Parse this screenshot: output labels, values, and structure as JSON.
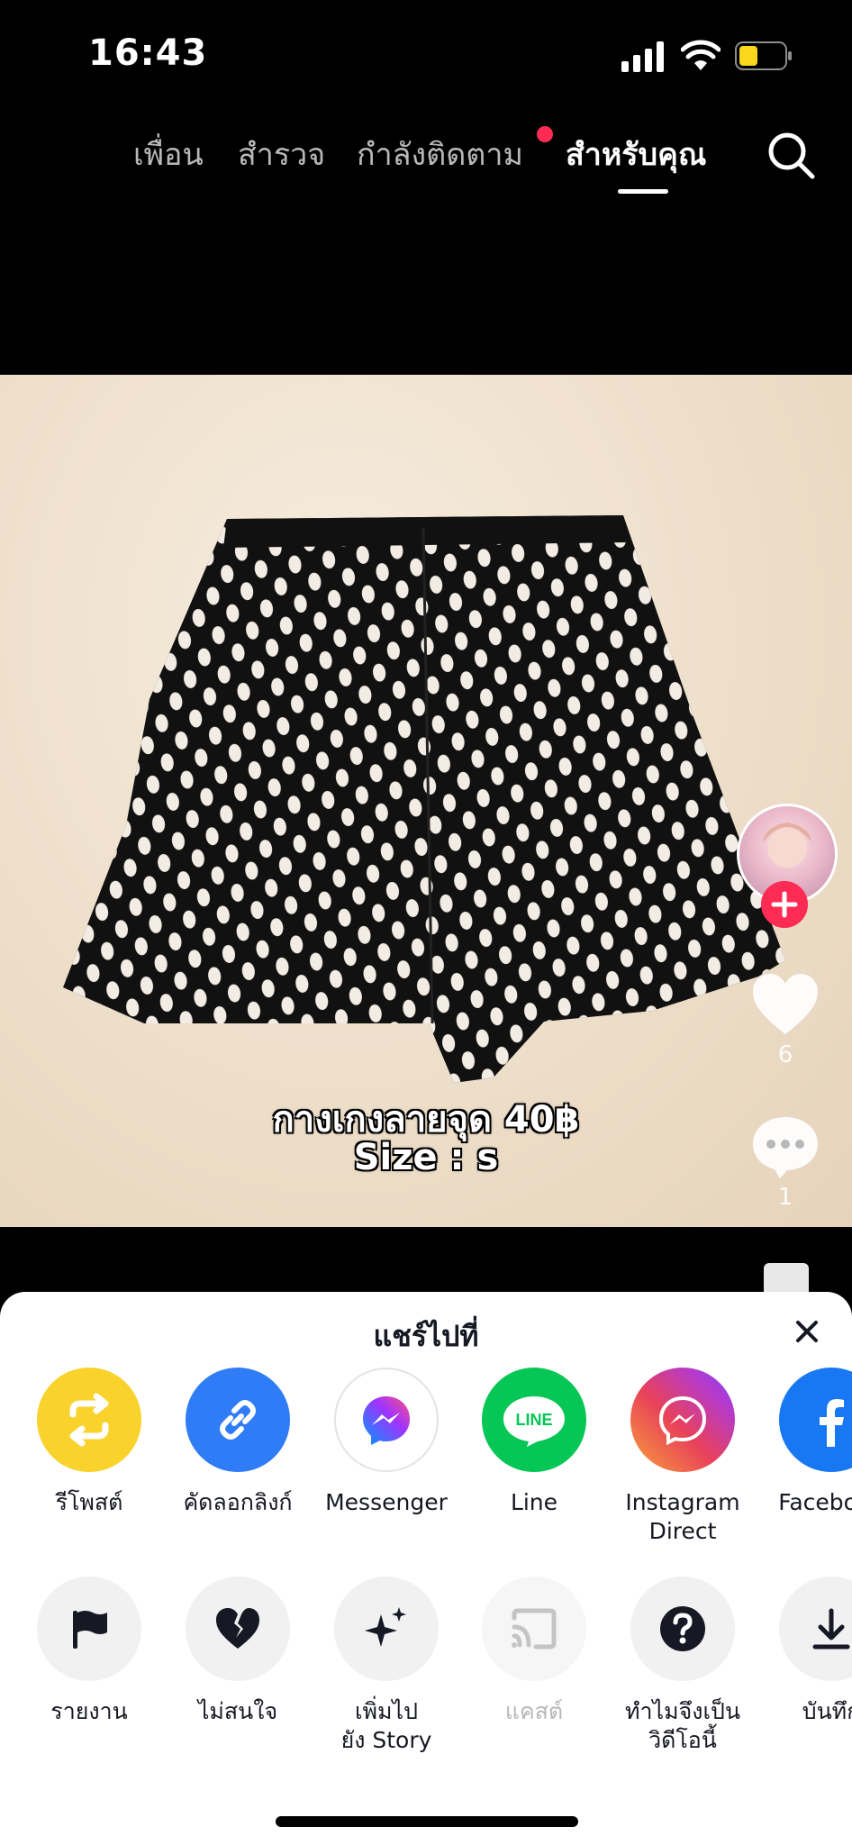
{
  "status_bar": {
    "time": "16:43",
    "battery_color": "#f9d71c"
  },
  "top_nav": {
    "tabs": [
      {
        "label": "เพื่อน"
      },
      {
        "label": "สำรวจ"
      },
      {
        "label": "กำลังติดตาม"
      },
      {
        "label": "สำหรับคุณ"
      }
    ],
    "active_tab": "สำหรับคุณ",
    "notification_dot_color": "#fe2c55"
  },
  "video": {
    "caption_line_1": "กางเกงลายจุด 40฿",
    "caption_line_2": "Size : s"
  },
  "actions": {
    "likes": "6",
    "comments": "1"
  },
  "share_sheet": {
    "title": "แชร์ไปที่",
    "share_targets": [
      {
        "label": "รีโพสต์",
        "icon": "repost-icon",
        "color": "#f9d22b"
      },
      {
        "label": "คัดลอกลิงก์",
        "icon": "link-icon",
        "color": "#2f7cf6"
      },
      {
        "label": "Messenger",
        "icon": "messenger-icon",
        "color": "#ffffff"
      },
      {
        "label": "Line",
        "icon": "line-icon",
        "color": "#06c755"
      },
      {
        "label": "Instagram\nDirect",
        "icon": "instagram-direct-icon",
        "color": "#d6249f"
      },
      {
        "label": "Facebook",
        "icon": "facebook-icon",
        "color": "#1877f2"
      }
    ],
    "more_actions": [
      {
        "label": "รายงาน",
        "icon": "flag-icon"
      },
      {
        "label": "ไม่สนใจ",
        "icon": "broken-heart-icon"
      },
      {
        "label": "เพิ่มไป\nยัง Story",
        "icon": "sparkle-icon"
      },
      {
        "label": "แคสต์",
        "icon": "cast-icon",
        "disabled": true
      },
      {
        "label": "ทำไมจึงเป็น\nวิดีโอนี้",
        "icon": "question-icon"
      },
      {
        "label": "บันทึก",
        "icon": "download-icon"
      }
    ]
  }
}
